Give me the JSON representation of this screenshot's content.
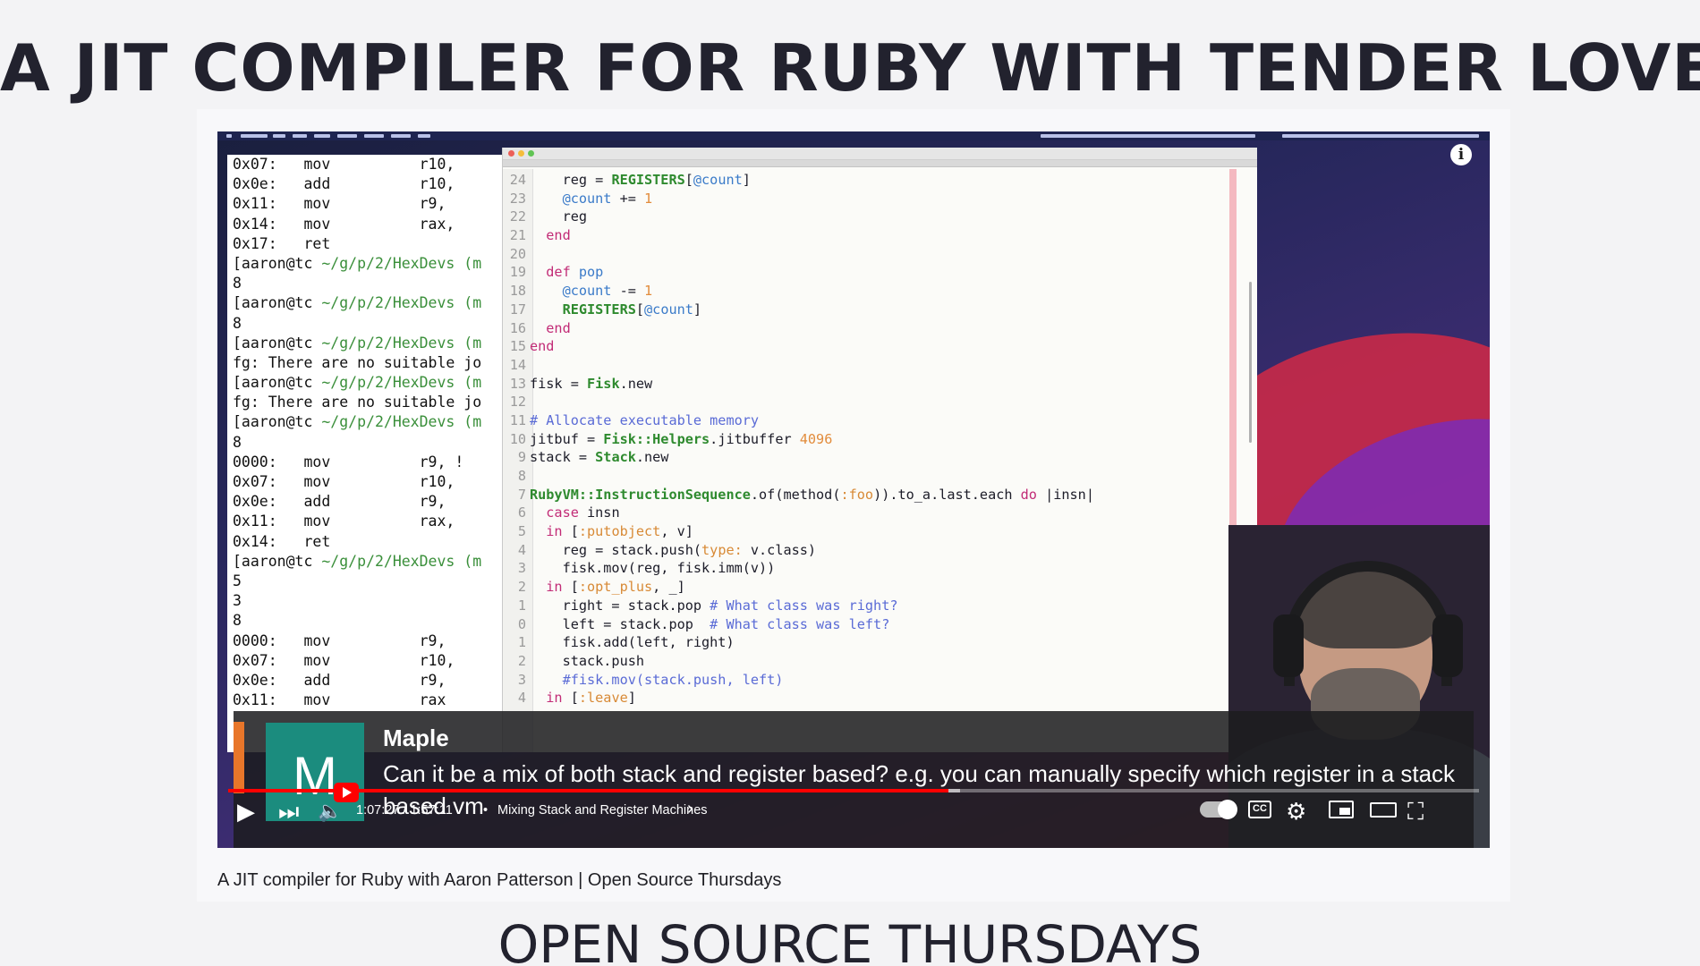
{
  "header": {
    "title": "A JIT COMPILER FOR RUBY WITH TENDER LOVE"
  },
  "terminal": {
    "lines": [
      [
        "0x07:   mov          r10,",
        ""
      ],
      [
        "0x0e:   add          r10,",
        ""
      ],
      [
        "0x11:   mov          r9, ",
        ""
      ],
      [
        "0x14:   mov          rax,",
        ""
      ],
      [
        "0x17:   ret",
        ""
      ],
      [
        "[aaron@tc ",
        "~/g/p/2/HexDevs (m"
      ],
      [
        "8",
        ""
      ],
      [
        "[aaron@tc ",
        "~/g/p/2/HexDevs (m"
      ],
      [
        "8",
        ""
      ],
      [
        "[aaron@tc ",
        "~/g/p/2/HexDevs (m"
      ],
      [
        "fg: There are no suitable jo",
        ""
      ],
      [
        "[aaron@tc ",
        "~/g/p/2/HexDevs (m"
      ],
      [
        "fg: There are no suitable jo",
        ""
      ],
      [
        "[aaron@tc ",
        "~/g/p/2/HexDevs (m"
      ],
      [
        "8",
        ""
      ],
      [
        "0000:   mov          r9, !",
        ""
      ],
      [
        "0x07:   mov          r10,",
        ""
      ],
      [
        "0x0e:   add          r9, ",
        ""
      ],
      [
        "0x11:   mov          rax,",
        ""
      ],
      [
        "0x14:   ret",
        ""
      ],
      [
        "[aaron@tc ",
        "~/g/p/2/HexDevs (m"
      ],
      [
        "5",
        ""
      ],
      [
        "3",
        ""
      ],
      [
        "8",
        ""
      ],
      [
        "0000:   mov          r9, ",
        ""
      ],
      [
        "0x07:   mov          r10,",
        ""
      ],
      [
        "0x0e:   add          r9, ",
        ""
      ],
      [
        "0x11:   mov          rax",
        ""
      ]
    ]
  },
  "editor": {
    "lines": [
      {
        "ln": "24",
        "tokens": [
          [
            "",
            "    reg = "
          ],
          [
            "const",
            "REGISTERS"
          ],
          [
            "",
            "["
          ],
          [
            "ivar",
            "@count"
          ],
          [
            "",
            "]"
          ]
        ]
      },
      {
        "ln": "23",
        "tokens": [
          [
            "ivar",
            "    @count"
          ],
          [
            "",
            " += "
          ],
          [
            "num",
            "1"
          ]
        ]
      },
      {
        "ln": "22",
        "tokens": [
          [
            "",
            "    reg"
          ]
        ]
      },
      {
        "ln": "21",
        "tokens": [
          [
            "kw",
            "  end"
          ]
        ]
      },
      {
        "ln": "20",
        "tokens": [
          [
            "",
            ""
          ]
        ]
      },
      {
        "ln": "19",
        "tokens": [
          [
            "kw",
            "  def"
          ],
          [
            "",
            " "
          ],
          [
            "ivar",
            "pop"
          ]
        ]
      },
      {
        "ln": "18",
        "tokens": [
          [
            "ivar",
            "    @count"
          ],
          [
            "",
            " -= "
          ],
          [
            "num",
            "1"
          ]
        ]
      },
      {
        "ln": "17",
        "tokens": [
          [
            "const",
            "    REGISTERS"
          ],
          [
            "",
            "["
          ],
          [
            "ivar",
            "@count"
          ],
          [
            "",
            "]"
          ]
        ]
      },
      {
        "ln": "16",
        "tokens": [
          [
            "kw",
            "  end"
          ]
        ]
      },
      {
        "ln": "15",
        "tokens": [
          [
            "kw",
            "end"
          ]
        ]
      },
      {
        "ln": "14",
        "tokens": [
          [
            "",
            ""
          ]
        ]
      },
      {
        "ln": "13",
        "tokens": [
          [
            "",
            "fisk = "
          ],
          [
            "const",
            "Fisk"
          ],
          [
            "",
            ".new"
          ]
        ]
      },
      {
        "ln": "12",
        "tokens": [
          [
            "",
            ""
          ]
        ]
      },
      {
        "ln": "11",
        "tokens": [
          [
            "cmt",
            "# Allocate executable memory"
          ]
        ]
      },
      {
        "ln": "10",
        "tokens": [
          [
            "",
            "jitbuf = "
          ],
          [
            "const",
            "Fisk::Helpers"
          ],
          [
            "",
            ".jitbuffer "
          ],
          [
            "num",
            "4096"
          ]
        ]
      },
      {
        "ln": "9",
        "tokens": [
          [
            "",
            "stack = "
          ],
          [
            "const",
            "Stack"
          ],
          [
            "",
            ".new"
          ]
        ]
      },
      {
        "ln": "8",
        "tokens": [
          [
            "",
            ""
          ]
        ]
      },
      {
        "ln": "7",
        "tokens": [
          [
            "const",
            "RubyVM::InstructionSequence"
          ],
          [
            "",
            ".of(method("
          ],
          [
            "sym",
            ":foo"
          ],
          [
            "",
            ")).to_a.last.each "
          ],
          [
            "kw",
            "do"
          ],
          [
            "",
            " |insn|"
          ]
        ]
      },
      {
        "ln": "6",
        "tokens": [
          [
            "kw",
            "  case"
          ],
          [
            "",
            " insn"
          ]
        ]
      },
      {
        "ln": "5",
        "tokens": [
          [
            "kw",
            "  in"
          ],
          [
            "",
            " ["
          ],
          [
            "sym",
            ":putobject"
          ],
          [
            "",
            ", v]"
          ]
        ]
      },
      {
        "ln": "4",
        "tokens": [
          [
            "",
            "    reg = stack.push("
          ],
          [
            "sym",
            "type:"
          ],
          [
            "",
            " v.class)"
          ]
        ]
      },
      {
        "ln": "3",
        "tokens": [
          [
            "",
            "    fisk.mov(reg, fisk.imm(v))"
          ]
        ]
      },
      {
        "ln": "2",
        "tokens": [
          [
            "kw",
            "  in"
          ],
          [
            "",
            " ["
          ],
          [
            "sym",
            ":opt_plus"
          ],
          [
            "",
            ", _]"
          ]
        ]
      },
      {
        "ln": "1",
        "tokens": [
          [
            "",
            "    right = stack.pop "
          ],
          [
            "cmt",
            "# What class was right?"
          ]
        ]
      },
      {
        "ln": "0",
        "tokens": [
          [
            "",
            "    left = stack.pop  "
          ],
          [
            "cmt",
            "# What class was left?"
          ]
        ]
      },
      {
        "ln": "1",
        "tokens": [
          [
            "",
            "    fisk.add(left, right)"
          ]
        ]
      },
      {
        "ln": "2",
        "tokens": [
          [
            "",
            "    stack.push"
          ]
        ]
      },
      {
        "ln": "3",
        "tokens": [
          [
            "cmt",
            "    #fisk.mov(stack.push, left)"
          ]
        ]
      },
      {
        "ln": "4",
        "tokens": [
          [
            "kw",
            "  in"
          ],
          [
            "",
            " ["
          ],
          [
            "sym",
            ":leave"
          ],
          [
            "",
            "]"
          ]
        ]
      }
    ]
  },
  "chat": {
    "avatar_letter": "M",
    "author": "Maple",
    "message": "Can it be a mix of both stack and register based? e.g. you can manually specify which register in a stack based vm"
  },
  "player": {
    "time": "1:07:27 / 1:57:11",
    "separator": "•",
    "chapter": "Mixing Stack and Register Machines",
    "chapter_arrow": "›",
    "played_fraction": 0.5755,
    "loaded_fraction": 0.585,
    "icons": {
      "play": "▶",
      "next": "⏭",
      "volume": "🔈",
      "settings": "⚙",
      "fullscreen": "⛶",
      "cc": "CC",
      "info": "i"
    },
    "colors": {
      "progress": "#ff0000",
      "avatar": "#1b8c7e"
    }
  },
  "caption": {
    "text": "A JIT compiler for Ruby with Aaron Patterson | Open Source Thursdays"
  },
  "footer": {
    "title": "OPEN SOURCE THURSDAYS"
  }
}
